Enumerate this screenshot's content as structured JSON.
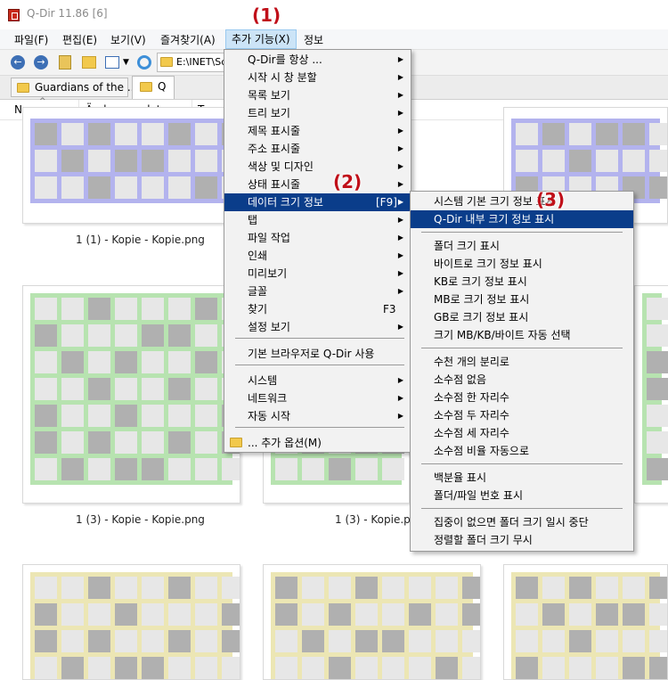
{
  "window": {
    "title": "Q-Dir 11.86 [6]"
  },
  "menubar": {
    "items": [
      {
        "label": "파일(F)"
      },
      {
        "label": "편집(E)"
      },
      {
        "label": "보기(V)"
      },
      {
        "label": "즐겨찾기(A)"
      },
      {
        "label": "추가 기능(X)"
      },
      {
        "label": "정보"
      }
    ]
  },
  "toolbar": {
    "address": "E:\\INET\\Sc"
  },
  "tabs": [
    {
      "label": "Guardians of the ..."
    },
    {
      "label": "Q"
    }
  ],
  "columns": [
    {
      "label": "Name"
    },
    {
      "label": "Änderungsdatum"
    },
    {
      "label": "Typ"
    }
  ],
  "files": [
    {
      "caption": "1 (1) - Kopie - Kopie.png",
      "color": "#b3b3ee"
    },
    {
      "caption": "1 (3) - Kopie - Kopie.png",
      "color": "#b7e3b0"
    },
    {
      "caption": "1 (3) - Kopie.png",
      "color": "#b7e3b0"
    }
  ],
  "thumb_colors": {
    "purple": "#b3b3ee",
    "green": "#b7e3b0",
    "yellow": "#ece6b4",
    "gray": "#b0b0b0",
    "light": "#e7e7e7"
  },
  "main_menu": {
    "items": [
      {
        "label": "Q-Dir를 항상 ..."
      },
      {
        "label": "시작 시 창 분할"
      },
      {
        "label": "목록 보기"
      },
      {
        "label": "트리 보기"
      },
      {
        "label": "제목 표시줄"
      },
      {
        "label": "주소 표시줄"
      },
      {
        "label": "색상 및 디자인"
      },
      {
        "label": "상태 표시줄"
      },
      {
        "label": "데이터 크기 정보",
        "shortcut": "[F9]"
      },
      {
        "label": "탭"
      },
      {
        "label": "파일 작업"
      },
      {
        "label": "인쇄"
      },
      {
        "label": "미리보기"
      },
      {
        "label": "글꼴"
      },
      {
        "label": "찾기",
        "shortcut": "F3"
      },
      {
        "label": "설정 보기"
      },
      {
        "label": "기본 브라우저로 Q-Dir 사용"
      },
      {
        "label": "시스템"
      },
      {
        "label": "네트워크"
      },
      {
        "label": "자동 시작"
      },
      {
        "label": "... 추가 옵션(M)"
      }
    ]
  },
  "sub_menu": {
    "items": [
      {
        "label": "시스템 기본 크기 정보 표시"
      },
      {
        "label": "Q-Dir 내부 크기 정보 표시"
      },
      {
        "label": "폴더 크기 표시"
      },
      {
        "label": "바이트로 크기 정보 표시"
      },
      {
        "label": "KB로 크기 정보 표시"
      },
      {
        "label": "MB로 크기 정보 표시"
      },
      {
        "label": "GB로 크기 정보 표시"
      },
      {
        "label": "크기 MB/KB/바이트 자동 선택"
      },
      {
        "label": "수천 개의 분리로"
      },
      {
        "label": "소수점 없음"
      },
      {
        "label": "소수점 한 자리수"
      },
      {
        "label": "소수점 두 자리수"
      },
      {
        "label": "소수점 세 자리수"
      },
      {
        "label": "소수점 비율 자동으로"
      },
      {
        "label": "백분율 표시"
      },
      {
        "label": "폴더/파일 번호 표시"
      },
      {
        "label": "집중이 없으면 폴더 크기 일시 중단"
      },
      {
        "label": "정렬할 폴더 크기 무시"
      }
    ]
  },
  "annotations": {
    "step1": "(1)",
    "step2": "(2)",
    "step3": "(3)"
  }
}
